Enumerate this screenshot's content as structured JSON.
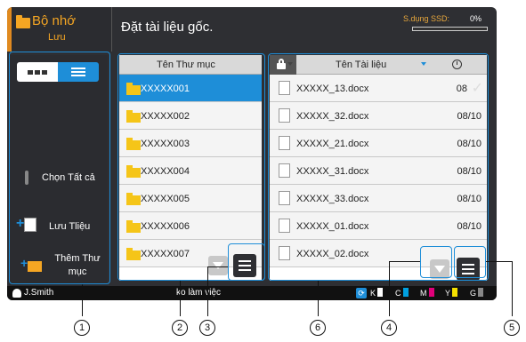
{
  "header": {
    "tab_title": "Bộ nhớ",
    "tab_subtitle": "Lưu",
    "title": "Đặt tài liệu gốc.",
    "ssd_label": "S.dụng SSD:",
    "ssd_value": "0%"
  },
  "left_panel": {
    "select_all": "Chọn Tất cả",
    "save_doc": "Lưu Tliệu",
    "add_folder": "Thêm Thư mục"
  },
  "folders": {
    "header": "Tên Thư mục",
    "rows": [
      "XXXXX001",
      "XXXXX002",
      "XXXXX003",
      "XXXXX004",
      "XXXXX005",
      "XXXXX006",
      "XXXXX007"
    ]
  },
  "docs": {
    "header": "Tên Tài liệu",
    "rows": [
      {
        "name": "XXXXX_13.docx",
        "date": "08"
      },
      {
        "name": "XXXXX_32.docx",
        "date": "08/10"
      },
      {
        "name": "XXXXX_21.docx",
        "date": "08/10"
      },
      {
        "name": "XXXXX_31.docx",
        "date": "08/10"
      },
      {
        "name": "XXXXX_33.docx",
        "date": "08/10"
      },
      {
        "name": "XXXXX_01.docx",
        "date": "08/10"
      },
      {
        "name": "XXXXX_02.docx",
        "date": ""
      }
    ]
  },
  "footer": {
    "user": "J.Smith",
    "status": "ko làm việc",
    "inks": [
      {
        "label": "K",
        "color": "#ffffff"
      },
      {
        "label": "C",
        "color": "#00a0e0"
      },
      {
        "label": "M",
        "color": "#e0007a"
      },
      {
        "label": "Y",
        "color": "#f5e000"
      },
      {
        "label": "G",
        "color": "#888888"
      }
    ]
  },
  "callouts": [
    "1",
    "2",
    "3",
    "6",
    "4",
    "5"
  ]
}
